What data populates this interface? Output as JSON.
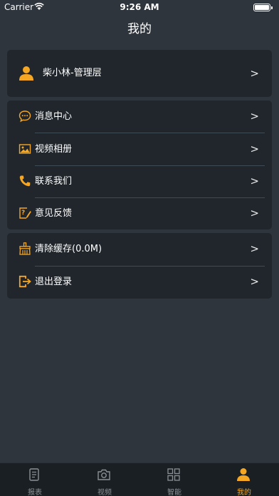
{
  "status_bar": {
    "carrier": "Carrier",
    "time": "9:26 AM"
  },
  "nav": {
    "title": "我的"
  },
  "profile": {
    "name": "柴小林-管理层",
    "icon": "user-icon"
  },
  "menu": [
    {
      "label": "消息中心",
      "icon": "message-icon"
    },
    {
      "label": "视频相册",
      "icon": "image-icon"
    },
    {
      "label": "联系我们",
      "icon": "phone-icon"
    },
    {
      "label": "意见反馈",
      "icon": "feedback-icon"
    }
  ],
  "settings": [
    {
      "label": "清除缓存(0.0M)",
      "icon": "broom-icon"
    },
    {
      "label": "退出登录",
      "icon": "logout-icon"
    }
  ],
  "chevron": ">",
  "tabs": [
    {
      "label": "报表",
      "icon": "report-icon",
      "active": false
    },
    {
      "label": "视频",
      "icon": "camera-icon",
      "active": false
    },
    {
      "label": "智能",
      "icon": "grid-icon",
      "active": false
    },
    {
      "label": "我的",
      "icon": "user-icon",
      "active": true
    }
  ],
  "colors": {
    "accent": "#f5a623",
    "background": "#2e353c",
    "card": "#20262c",
    "tabbar": "#1a1f23"
  }
}
